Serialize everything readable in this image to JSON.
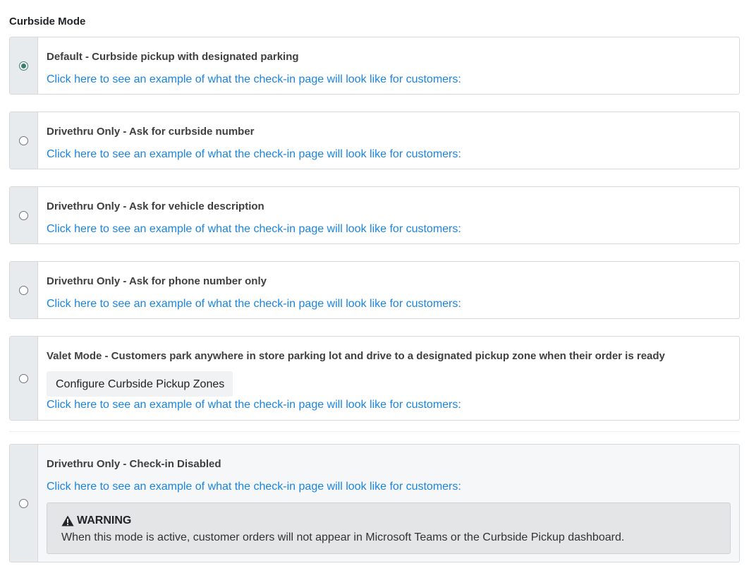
{
  "section_title": "Curbside Mode",
  "link_text": "Click here to see an example of what the check-in page will look like for customers:",
  "options": [
    {
      "label": "Default - Curbside pickup with designated parking",
      "selected": true
    },
    {
      "label": "Drivethru Only - Ask for curbside number",
      "selected": false
    },
    {
      "label": "Drivethru Only - Ask for vehicle description",
      "selected": false
    },
    {
      "label": "Drivethru Only - Ask for phone number only",
      "selected": false
    },
    {
      "label": "Valet Mode - Customers park anywhere in store parking lot and drive to a designated pickup zone when their order is ready",
      "selected": false,
      "button_label": "Configure Curbside Pickup Zones"
    },
    {
      "label": "Drivethru Only - Check-in Disabled",
      "selected": false
    }
  ],
  "warning": {
    "icon": "warning-triangle-icon",
    "title": "WARNING",
    "text": "When this mode is active, customer orders will not appear in Microsoft Teams or the Curbside Pickup dashboard."
  },
  "colors": {
    "accent": "#3b7f73",
    "link": "#1a85e0",
    "radio_column": "#e8ebee"
  }
}
